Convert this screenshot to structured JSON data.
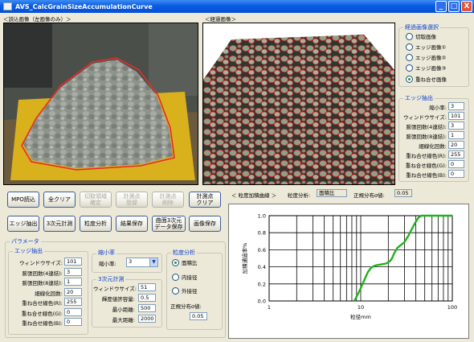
{
  "window": {
    "title": "AVS_CalcGrainSizeAccumulationCurve",
    "minimize": "_",
    "maximize": "□",
    "close": "X"
  },
  "panels": {
    "left_image_label": "＜読込画像（左画像のみ）＞",
    "right_image_label": "＜経過画像＞"
  },
  "image_select": {
    "title": "経過画像選択",
    "options": [
      "切取画像",
      "エッジ画像①",
      "エッジ画像②",
      "エッジ画像③",
      "重ね合せ画像"
    ],
    "selected_index": 4
  },
  "edge_top": {
    "title": "エッジ抽出",
    "rows": [
      {
        "label": "縮小率:",
        "value": "3"
      },
      {
        "label": "ウィンドウサイズ:",
        "value": "101"
      },
      {
        "label": "膨張回数(4連結):",
        "value": "3"
      },
      {
        "label": "膨張回数(8連結):",
        "value": "1"
      },
      {
        "label": "細線化回数:",
        "value": "20"
      },
      {
        "label": "重ね合せ線色(R):",
        "value": "255"
      },
      {
        "label": "重ね合せ線色(G):",
        "value": "0"
      },
      {
        "label": "重ね合せ線色(B):",
        "value": "0"
      }
    ]
  },
  "buttons": {
    "row1": [
      "MPO読込",
      "全クリア",
      "切取領域\n確定",
      "計測点\n登録",
      "計測点\n削除",
      "計測点\nクリア"
    ],
    "row1_disabled": [
      false,
      false,
      true,
      true,
      true,
      false
    ],
    "row2": [
      "エッジ抽出",
      "3次元計測",
      "粒度分析",
      "結果保存",
      "曲面3次元\nデータ保存",
      "画像保存"
    ]
  },
  "params": {
    "title": "パラメータ",
    "edge": {
      "title": "エッジ抽出",
      "rows": [
        {
          "label": "ウィンドウサイズ:",
          "value": "101"
        },
        {
          "label": "膨張回数(4連結):",
          "value": "3"
        },
        {
          "label": "膨張回数(8連結):",
          "value": "1"
        },
        {
          "label": "細線化回数:",
          "value": "20"
        },
        {
          "label": "重ね合せ線色(R):",
          "value": "255"
        },
        {
          "label": "重ね合せ線色(G):",
          "value": "0"
        },
        {
          "label": "重ね合せ線色(B):",
          "value": "0"
        }
      ]
    },
    "shrink": {
      "title": "縮小率",
      "label": "縮小率:",
      "value": "3"
    },
    "measure3d": {
      "title": "3次元計測",
      "rows": [
        {
          "label": "ウィンドウサイズ:",
          "value": "51"
        },
        {
          "label": "輝度値許容量:",
          "value": "0.5"
        },
        {
          "label": "最小距離:",
          "value": "500"
        },
        {
          "label": "最大距離:",
          "value": "2000"
        }
      ]
    },
    "grain": {
      "title": "粒度分析",
      "options": [
        "面積比",
        "内接径",
        "外接径"
      ],
      "selected_index": 0,
      "sigma_label": "正規分布σ値:",
      "sigma_value": "0.05"
    }
  },
  "curve": {
    "title": "＜ 粒度加積曲線 ＞",
    "analysis_label": "粒度分析:",
    "analysis_value": "面積比",
    "sigma_label": "正規分布σ値:",
    "sigma_value": "0.05",
    "line_color": "#22b11d"
  },
  "chart_data": {
    "type": "line",
    "xlabel": "粒径mm",
    "ylabel": "加積通過率%",
    "x_scale": "log",
    "xlim": [
      1,
      100
    ],
    "ylim": [
      0,
      1
    ],
    "x_ticks": [
      "1",
      "10",
      "100"
    ],
    "y_ticks": [
      "0.0",
      "0.2",
      "0.4",
      "0.6",
      "0.8",
      "1.0"
    ],
    "grid": true,
    "series": [
      {
        "x": [
          8.5,
          9.0,
          9.5,
          10,
          11,
          12,
          13,
          14,
          15,
          17,
          19,
          21,
          22,
          23,
          25,
          27,
          30,
          33,
          36,
          40,
          43,
          46
        ],
        "y": [
          0.0,
          0.05,
          0.1,
          0.15,
          0.25,
          0.34,
          0.39,
          0.41,
          0.42,
          0.43,
          0.44,
          0.47,
          0.5,
          0.55,
          0.62,
          0.65,
          0.69,
          0.76,
          0.84,
          0.93,
          0.98,
          1.0
        ]
      }
    ]
  }
}
